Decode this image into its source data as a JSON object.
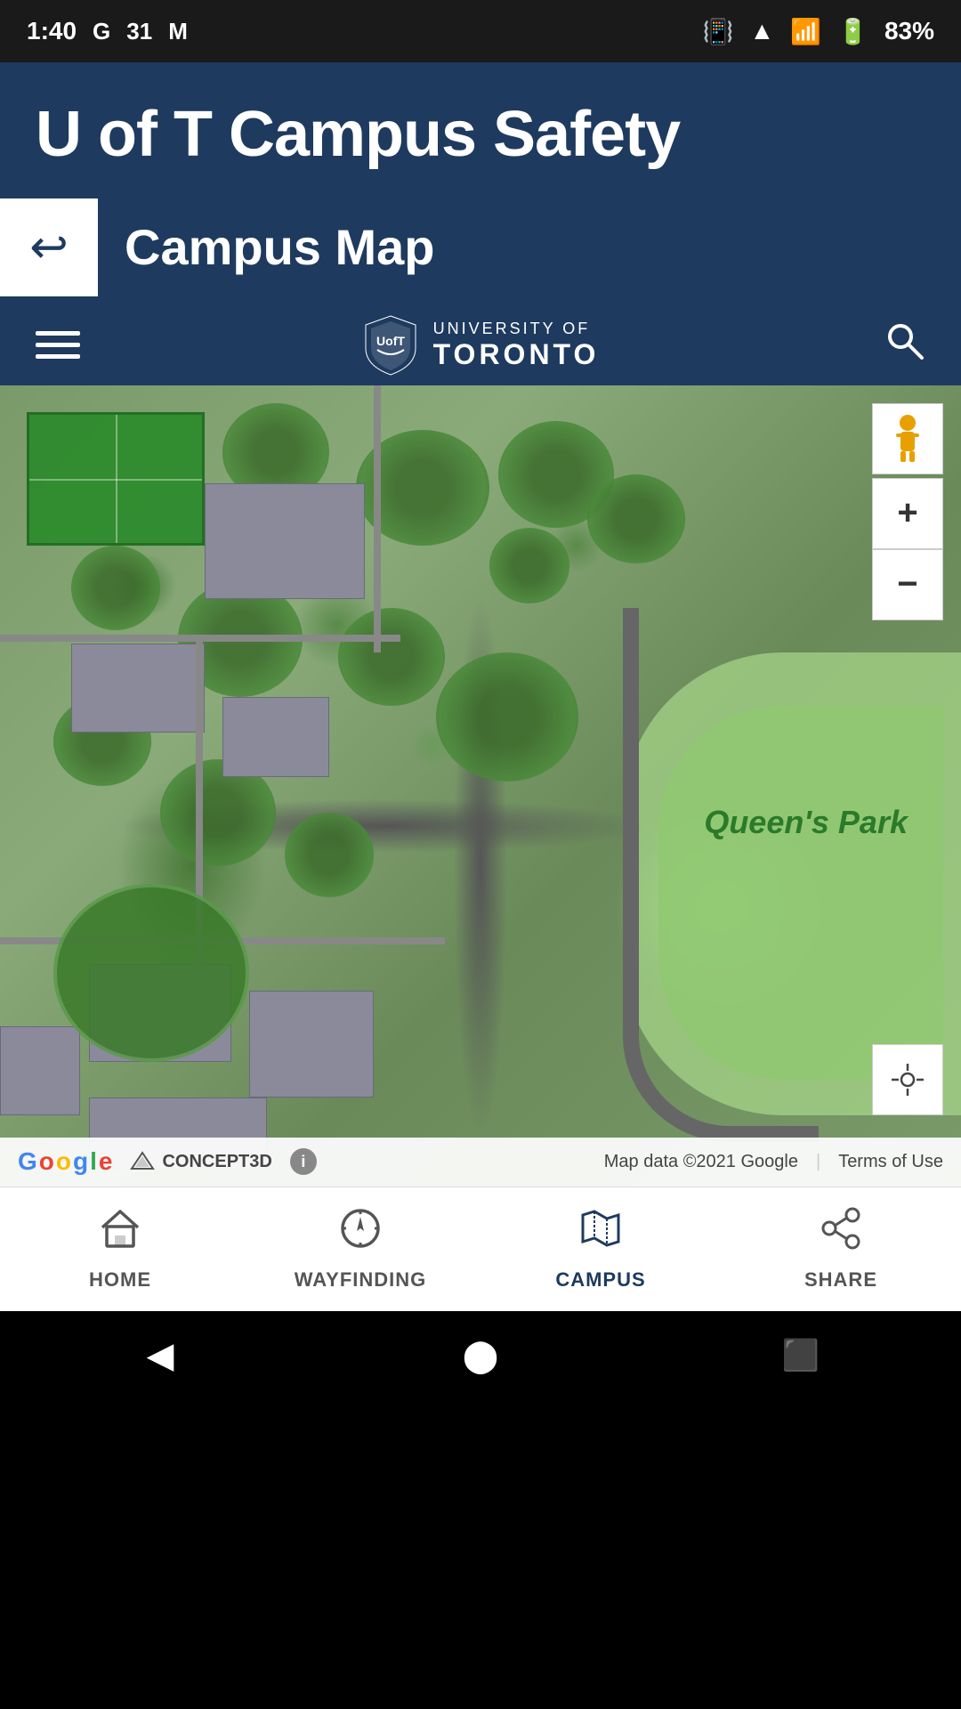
{
  "statusBar": {
    "time": "1:40",
    "battery": "83%",
    "icons": [
      "G",
      "31",
      "M"
    ]
  },
  "appHeader": {
    "title": "U of T Campus Safety"
  },
  "pageTitle": {
    "backButtonLabel": "←",
    "title": "Campus Map"
  },
  "mapToolbar": {
    "logoTextSmall": "UNIVERSITY OF",
    "logoTextLarge": "TORONTO"
  },
  "mapControls": {
    "zoomInLabel": "+",
    "zoomOutLabel": "−",
    "pegmanLabel": "👤"
  },
  "mapLabels": {
    "queensPark": "Queen's Park"
  },
  "mapAttribution": {
    "googleText": "Google",
    "concept3dText": "CONCEPT3D",
    "mapData": "Map data ©2021 Google",
    "termsText": "Terms of Use",
    "infoLabel": "i"
  },
  "bottomNav": {
    "items": [
      {
        "id": "home",
        "label": "HOME",
        "active": false
      },
      {
        "id": "wayfinding",
        "label": "WAYFINDING",
        "active": false
      },
      {
        "id": "campus",
        "label": "CAMPUS",
        "active": true
      },
      {
        "id": "share",
        "label": "SHARE",
        "active": false
      }
    ]
  },
  "systemNav": {
    "backLabel": "◀",
    "homeLabel": "⬤",
    "recentLabel": "⬛"
  }
}
